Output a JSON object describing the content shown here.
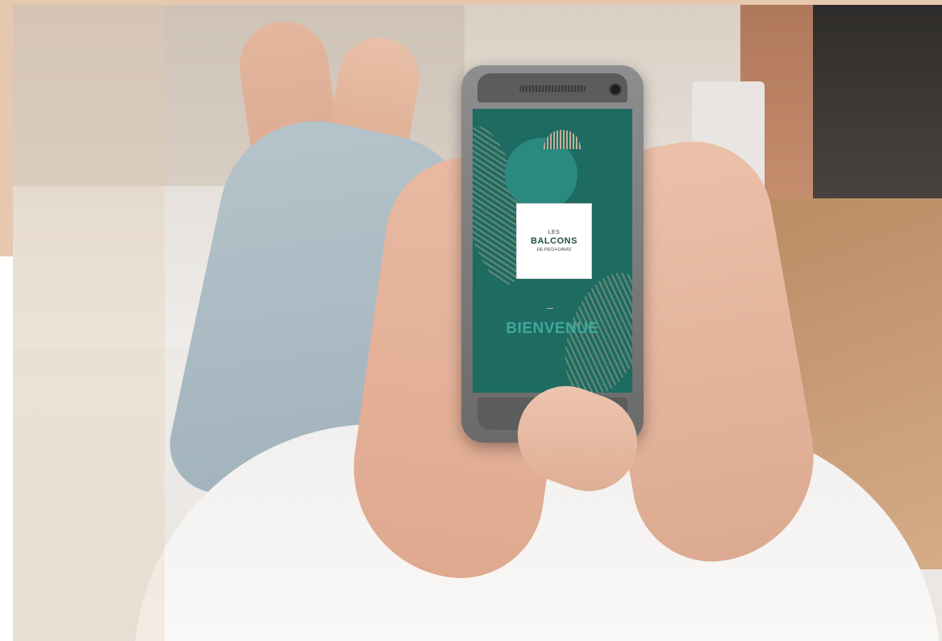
{
  "phone_screen": {
    "logo": {
      "line_top": "LES",
      "line_main": "BALCONS",
      "line_bottom": "DE PECH-DAVID"
    },
    "welcome_text": "BIENVENUE"
  },
  "colors": {
    "accent_beige": "#e6c8ae",
    "screen_teal": "#1e6b62",
    "welcome_teal": "#3fa89b"
  }
}
